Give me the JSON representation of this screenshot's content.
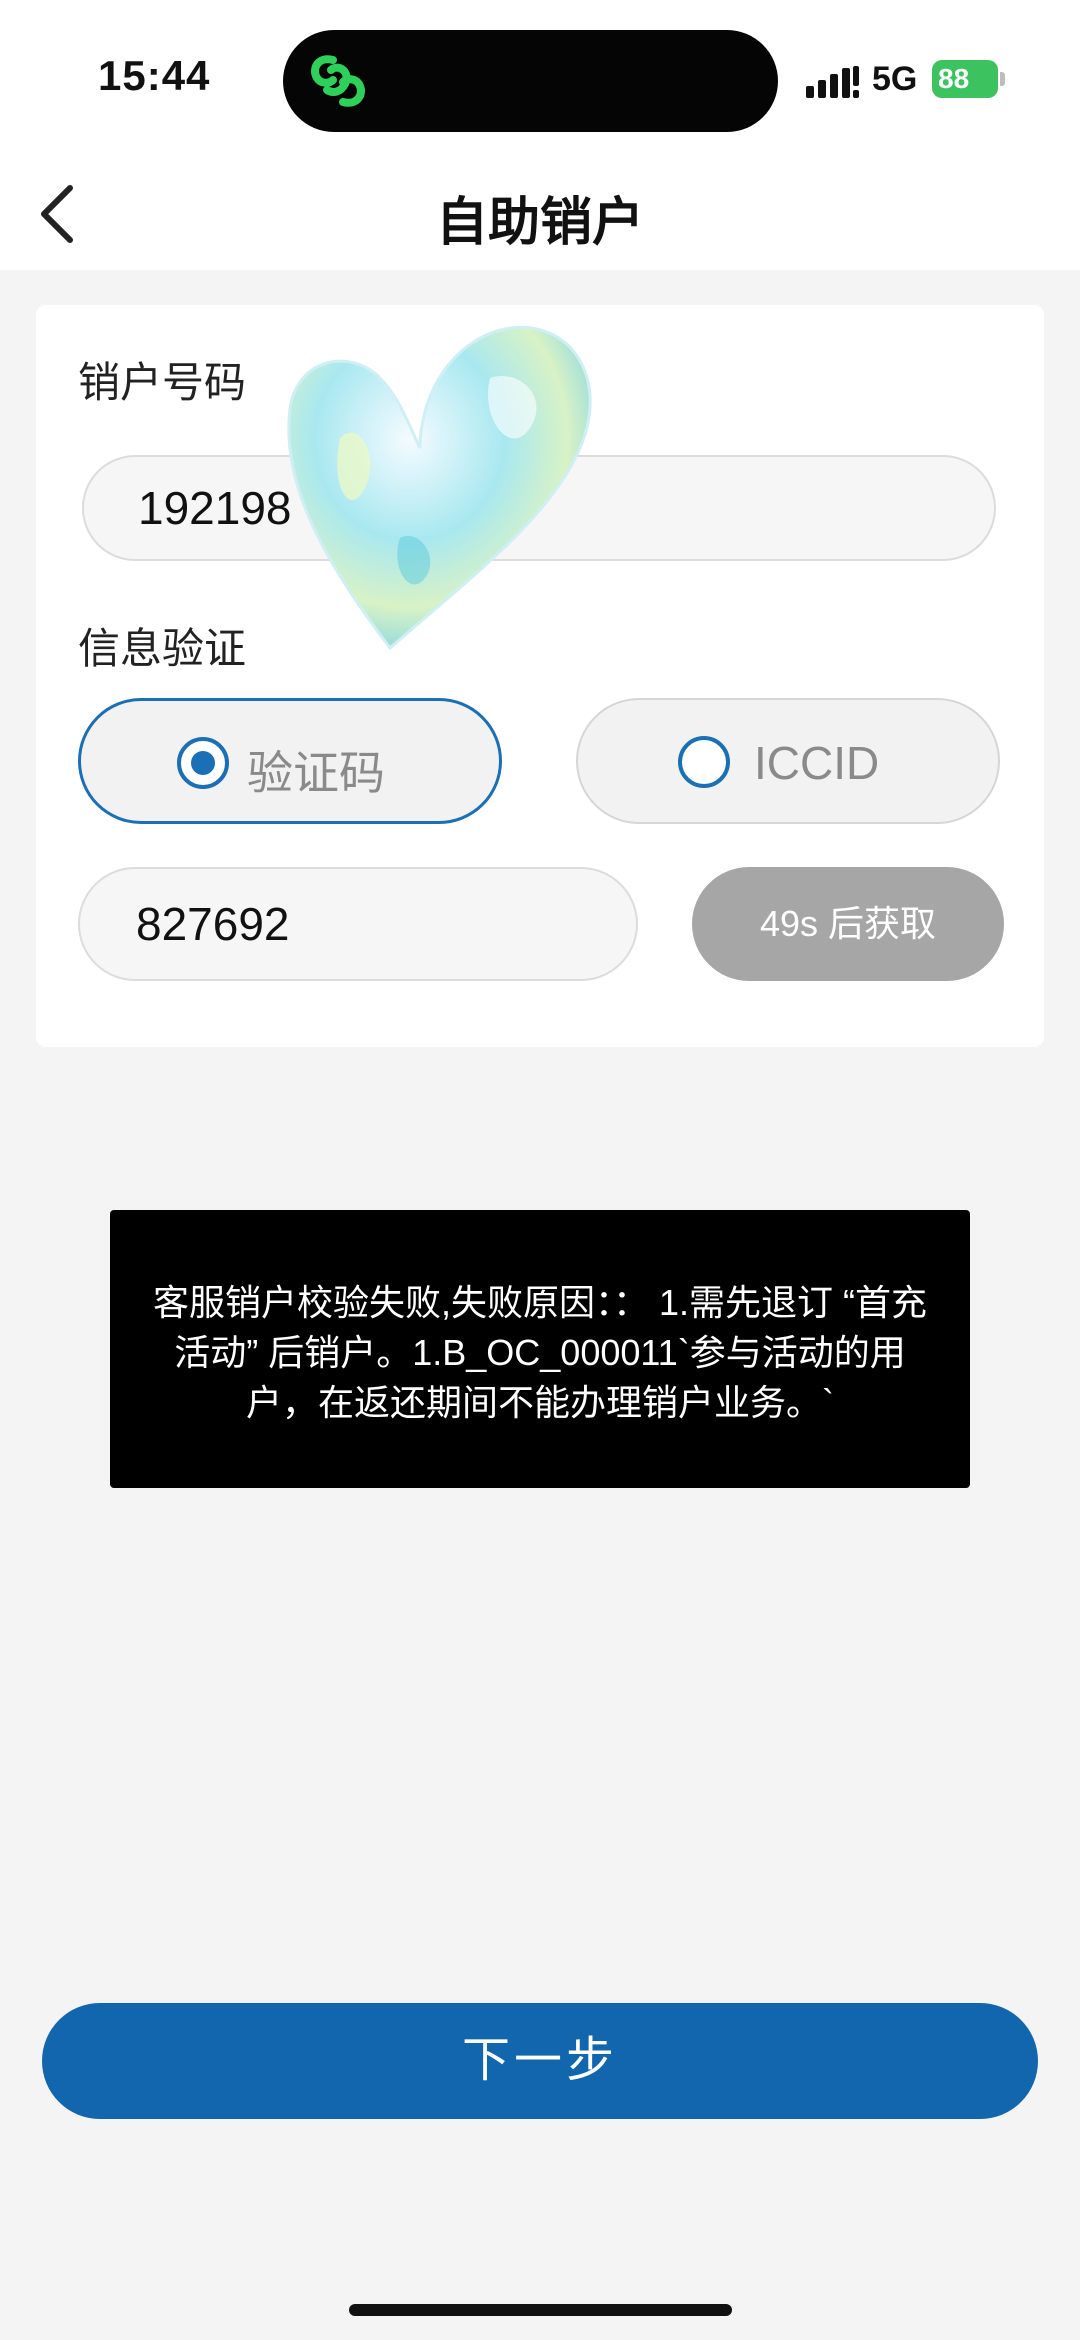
{
  "status_bar": {
    "time": "15:44",
    "network": "5G",
    "battery": "88",
    "icons": [
      "app-link-icon",
      "signal-icon",
      "battery-charging-icon"
    ]
  },
  "nav": {
    "title": "自助销户",
    "back_icon": "chevron-left-icon"
  },
  "form": {
    "phone_label": "销户号码",
    "phone_value": "192198",
    "verify_label": "信息验证",
    "options": [
      {
        "label": "验证码",
        "selected": true
      },
      {
        "label": "ICCID",
        "selected": false
      }
    ],
    "code_value": "827692",
    "countdown_label": "49s 后获取"
  },
  "toast": {
    "message": "客服销户校验失败,失败原因：： 1.需先退订 “首充活动” 后销户。1.B_OC_000011`参与活动的用户，在返还期间不能办理销户业务。`"
  },
  "footer": {
    "next_label": "下一步"
  },
  "colors": {
    "accent": "#1266ad",
    "radio": "#1a6fb5",
    "disabled_button": "#a6a6a6",
    "battery": "#3cc35f"
  }
}
